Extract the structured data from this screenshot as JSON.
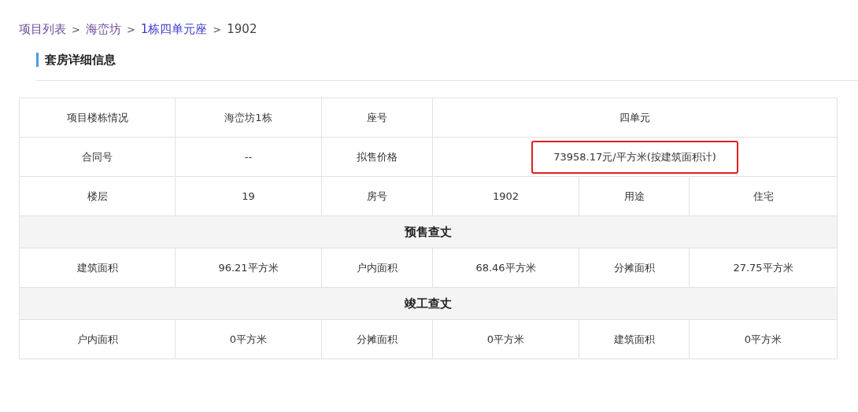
{
  "breadcrumb": [
    {
      "kind": "link",
      "text": "项目列表",
      "color": "#6b4a9a"
    },
    {
      "kind": "separator",
      "text": ">"
    },
    {
      "kind": "link",
      "text": "海峦坊",
      "color": "#6b4a9a"
    },
    {
      "kind": "separator",
      "text": ">"
    },
    {
      "kind": "link",
      "text": "1栋四单元座",
      "color": "#3b3bd0"
    },
    {
      "kind": "separator",
      "text": ">"
    },
    {
      "kind": "current",
      "text": "1902"
    }
  ],
  "section_title": "套房详细信息",
  "table": {
    "rows": [
      {
        "kind": "data",
        "cells": [
          {
            "text": "项目楼栋情况",
            "highlighted": false
          },
          {
            "text": "海峦坊1栋",
            "highlighted": false
          },
          {
            "text": "座号",
            "highlighted": false
          },
          {
            "text": "四单元",
            "colspan": 3,
            "highlighted": false
          }
        ]
      },
      {
        "kind": "data",
        "cells": [
          {
            "text": "合同号",
            "highlighted": false
          },
          {
            "text": "--",
            "highlighted": false
          },
          {
            "text": "拟售价格",
            "highlighted": false
          },
          {
            "text": "73958.17元/平方米(按建筑面积计)",
            "colspan": 3,
            "highlighted": true
          }
        ]
      },
      {
        "kind": "data",
        "cells": [
          {
            "text": "楼层",
            "highlighted": false
          },
          {
            "text": "19",
            "highlighted": false
          },
          {
            "text": "房号",
            "highlighted": false
          },
          {
            "text": "1902",
            "highlighted": false
          },
          {
            "text": "用途",
            "highlighted": false
          },
          {
            "text": "住宅",
            "highlighted": false
          }
        ]
      },
      {
        "kind": "section",
        "cells": [
          {
            "text": "预售查丈",
            "colspan": 6,
            "highlighted": false
          }
        ]
      },
      {
        "kind": "data",
        "cells": [
          {
            "text": "建筑面积",
            "highlighted": false
          },
          {
            "text": "96.21平方米",
            "highlighted": false
          },
          {
            "text": "户内面积",
            "highlighted": false
          },
          {
            "text": "68.46平方米",
            "highlighted": false
          },
          {
            "text": "分摊面积",
            "highlighted": false
          },
          {
            "text": "27.75平方米",
            "highlighted": false
          }
        ]
      },
      {
        "kind": "section",
        "cells": [
          {
            "text": "竣工查丈",
            "colspan": 6,
            "highlighted": false
          }
        ]
      },
      {
        "kind": "data",
        "cells": [
          {
            "text": "户内面积",
            "highlighted": false
          },
          {
            "text": "0平方米",
            "highlighted": false
          },
          {
            "text": "分摊面积",
            "highlighted": false
          },
          {
            "text": "0平方米",
            "highlighted": false
          },
          {
            "text": "建筑面积",
            "highlighted": false
          },
          {
            "text": "0平方米",
            "highlighted": false
          }
        ]
      }
    ]
  }
}
